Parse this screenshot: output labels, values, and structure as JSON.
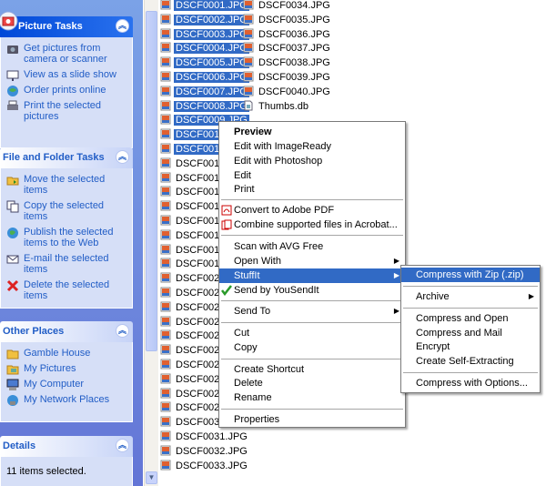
{
  "task_pane": {
    "picture_tasks": {
      "title": "Picture Tasks",
      "items": [
        "Get pictures from camera or scanner",
        "View as a slide show",
        "Order prints online",
        "Print the selected pictures"
      ]
    },
    "file_folder_tasks": {
      "title": "File and Folder Tasks",
      "items": [
        "Move the selected items",
        "Copy the selected items",
        "Publish the selected items to the Web",
        "E-mail the selected items",
        "Delete the selected items"
      ]
    },
    "other_places": {
      "title": "Other Places",
      "items": [
        "Gamble House",
        "My Pictures",
        "My Computer",
        "My Network Places"
      ]
    },
    "details": {
      "title": "Details",
      "text": "11 items selected."
    }
  },
  "files": {
    "column1": [
      "DSCF0001.JPG",
      "DSCF0002.JPG",
      "DSCF0003.JPG",
      "DSCF0004.JPG",
      "DSCF0005.JPG",
      "DSCF0006.JPG",
      "DSCF0007.JPG",
      "DSCF0008.JPG",
      "DSCF0009.JPG",
      "DSCF0010.",
      "DSCF0011.",
      "DSCF0012.",
      "DSCF0013.",
      "DSCF0014.",
      "DSCF0015.",
      "DSCF0016.",
      "DSCF0017.",
      "DSCF0018.",
      "DSCF0019.",
      "DSCF0020.",
      "DSCF0021.",
      "DSCF0022.",
      "DSCF0023.",
      "DSCF0024.",
      "DSCF0025.",
      "DSCF0026.",
      "DSCF0027.",
      "DSCF0028.",
      "DSCF0029.",
      "DSCF0030.",
      "DSCF0031.JPG",
      "DSCF0032.JPG",
      "DSCF0033.JPG"
    ],
    "column2": [
      "DSCF0034.JPG",
      "DSCF0035.JPG",
      "DSCF0036.JPG",
      "DSCF0037.JPG",
      "DSCF0038.JPG",
      "DSCF0039.JPG",
      "DSCF0040.JPG",
      "Thumbs.db"
    ]
  },
  "context_menu": {
    "preview": "Preview",
    "edit_imageready": "Edit with ImageReady",
    "edit_photoshop": "Edit with Photoshop",
    "edit": "Edit",
    "print": "Print",
    "convert_pdf": "Convert to Adobe PDF",
    "combine_acrobat": "Combine supported files in Acrobat...",
    "scan_avg": "Scan with AVG Free",
    "open_with": "Open With",
    "stuffit": "StuffIt",
    "send_yousendit": "Send by YouSendIt",
    "send_to": "Send To",
    "cut": "Cut",
    "copy": "Copy",
    "create_shortcut": "Create Shortcut",
    "delete": "Delete",
    "rename": "Rename",
    "properties": "Properties"
  },
  "submenu": {
    "compress_zip": "Compress with Zip (.zip)",
    "archive": "Archive",
    "compress_open": "Compress and Open",
    "compress_mail": "Compress and Mail",
    "encrypt": "Encrypt",
    "create_self_extracting": "Create Self-Extracting",
    "compress_options": "Compress with Options..."
  },
  "colors": {
    "selection": "#316ac5",
    "task_link": "#215dc6",
    "pane_top": "#7ba2e7",
    "pane_bottom": "#6375d6"
  },
  "icons": {
    "file": "jpg-image-icon",
    "thumbs": "thumbs-db-icon"
  }
}
